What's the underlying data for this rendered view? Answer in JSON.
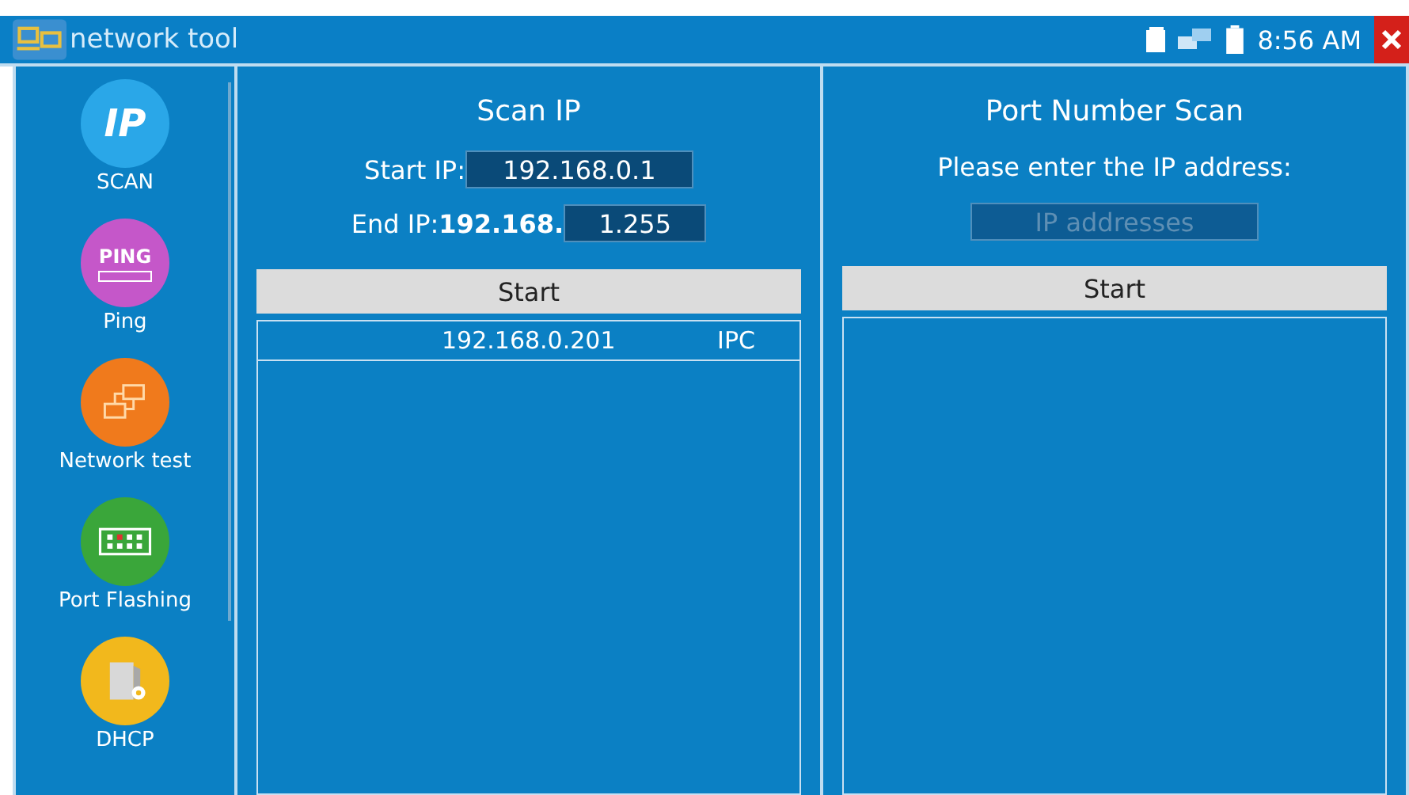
{
  "window": {
    "title": "network tool",
    "time": "8:56 AM"
  },
  "sidebar": {
    "items": [
      {
        "kind": "ip",
        "label": "SCAN",
        "icon_text": "IP"
      },
      {
        "kind": "ping",
        "label": "Ping",
        "icon_text": "PING"
      },
      {
        "kind": "network",
        "label": "Network test"
      },
      {
        "kind": "port",
        "label": "Port Flashing"
      },
      {
        "kind": "dhcp",
        "label": "DHCP"
      }
    ]
  },
  "scan_ip": {
    "title": "Scan IP",
    "start_label": "Start IP:",
    "start_value": "192.168.0.1",
    "end_label": "End IP:",
    "end_prefix": "192.168.",
    "end_value": "1.255",
    "button": "Start",
    "results": [
      {
        "ip": "192.168.0.201",
        "type": "IPC"
      }
    ]
  },
  "port_scan": {
    "title": "Port Number Scan",
    "prompt": "Please enter the IP address:",
    "placeholder": "IP addresses",
    "button": "Start"
  }
}
